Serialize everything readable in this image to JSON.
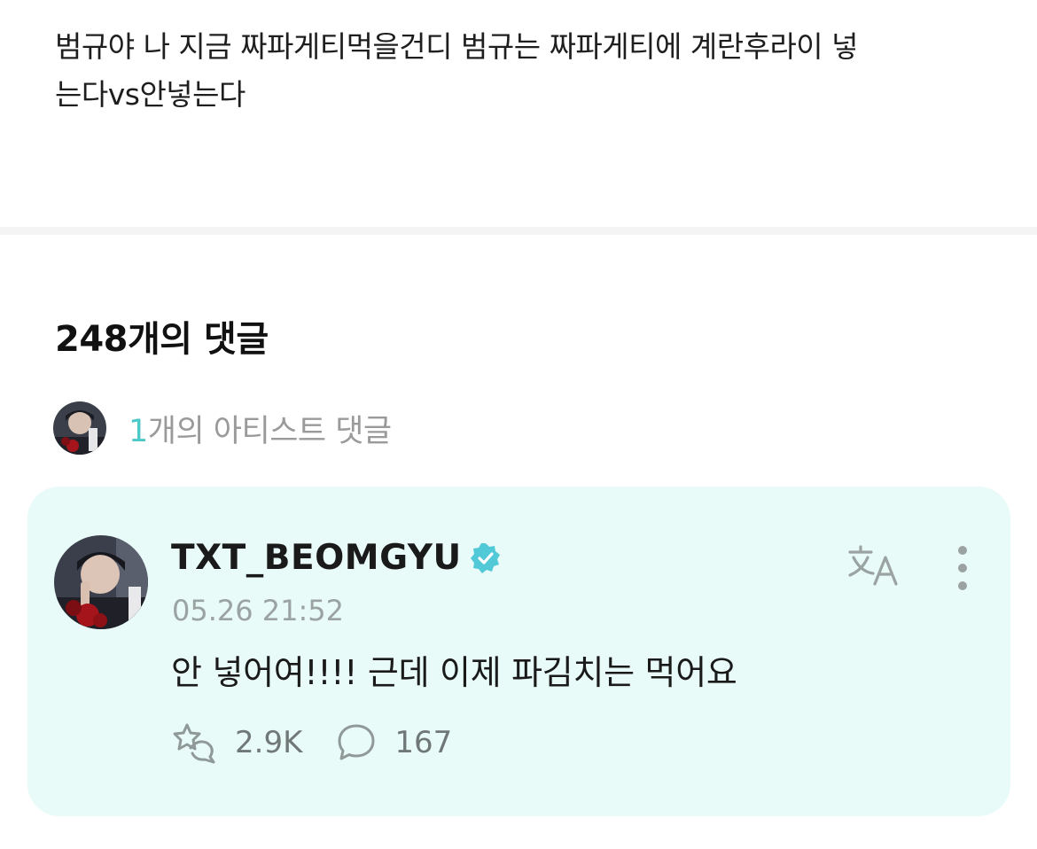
{
  "post": {
    "body_line1": "범규야 나 지금 짜파게티먹을건디 범규는 짜파게티에 계란후라이 넣",
    "body_line2": "는다vs안넣는다"
  },
  "comments": {
    "heading": "248개의 댓글",
    "artist_summary": {
      "count": "1",
      "label": "개의 아티스트 댓글"
    }
  },
  "artist_comment": {
    "author": "TXT_BEOMGYU",
    "timestamp": "05.26 21:52",
    "text": "안 넣어여!!!! 근데 이제 파김치는 먹어요",
    "likes": "2.9K",
    "replies": "167"
  },
  "icons": {
    "verified": "verified-badge-icon",
    "translate": "translate-icon",
    "more": "more-vertical-icon",
    "like": "like-icon",
    "reply": "reply-bubble-icon"
  },
  "colors": {
    "accent": "#4ec9c9",
    "card_background": "#e8fbf8",
    "verified_badge": "#52c9d6",
    "icon_gray": "#8f9998"
  }
}
